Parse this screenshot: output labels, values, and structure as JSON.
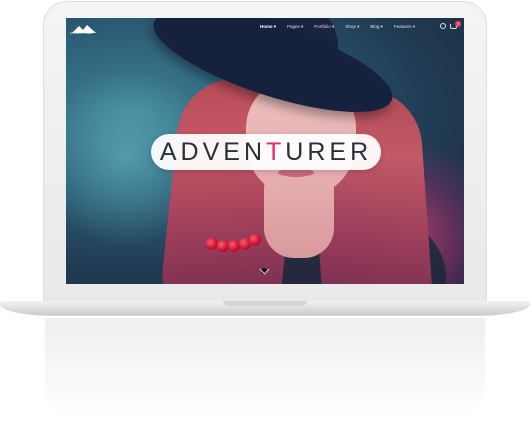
{
  "nav": {
    "logo_text": "ADVENTURER",
    "items": [
      {
        "label": "Home ▾",
        "active": true
      },
      {
        "label": "Pages ▾",
        "active": false
      },
      {
        "label": "Portfolio ▾",
        "active": false
      },
      {
        "label": "Shop ▾",
        "active": false
      },
      {
        "label": "Blog ▾",
        "active": false
      },
      {
        "label": "Features ▾",
        "active": false
      }
    ],
    "cart_count": "0"
  },
  "hero": {
    "title_part1": "ADVEN",
    "title_accent": "T",
    "title_part2": "URER",
    "accent_color": "#e22a69"
  },
  "icons": [
    "logo-mountain-icon",
    "search-icon",
    "cart-icon",
    "chevron-down-icon"
  ]
}
